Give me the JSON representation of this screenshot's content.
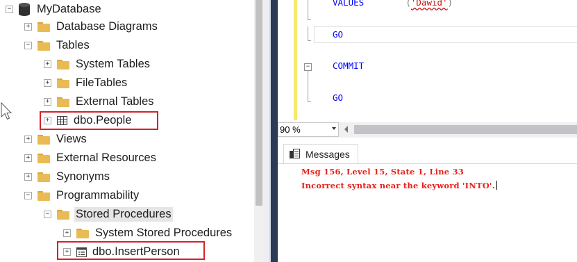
{
  "object_explorer": {
    "nodes": [
      {
        "label": "MyDatabase",
        "expander": "−",
        "icon": "database-icon"
      },
      {
        "label": "Database Diagrams",
        "expander": "+",
        "icon": "folder-icon"
      },
      {
        "label": "Tables",
        "expander": "−",
        "icon": "folder-icon"
      },
      {
        "label": "System Tables",
        "expander": "+",
        "icon": "folder-icon"
      },
      {
        "label": "FileTables",
        "expander": "+",
        "icon": "folder-icon"
      },
      {
        "label": "External Tables",
        "expander": "+",
        "icon": "folder-icon"
      },
      {
        "label": "dbo.People",
        "expander": "+",
        "icon": "table-icon",
        "highlighted": true
      },
      {
        "label": "Views",
        "expander": "+",
        "icon": "folder-icon"
      },
      {
        "label": "External Resources",
        "expander": "+",
        "icon": "folder-icon"
      },
      {
        "label": "Synonyms",
        "expander": "+",
        "icon": "folder-icon"
      },
      {
        "label": "Programmability",
        "expander": "−",
        "icon": "folder-icon"
      },
      {
        "label": "Stored Procedures",
        "expander": "−",
        "icon": "folder-icon",
        "selected": true
      },
      {
        "label": "System Stored Procedures",
        "expander": "+",
        "icon": "folder-icon"
      },
      {
        "label": "dbo.InsertPerson",
        "expander": "+",
        "icon": "stored-procedure-icon",
        "highlighted": true
      }
    ],
    "highlight_color": "#d4222a"
  },
  "editor": {
    "lines": [
      {
        "keyword": "VALUES",
        "punct_open": "(",
        "string": "'Dawid'",
        "punct_close": ")"
      },
      {
        "keyword": "GO"
      },
      {
        "keyword": "COMMIT"
      },
      {
        "keyword": "GO"
      }
    ],
    "fold_expander": "−",
    "keyword_color": "#0000ff",
    "string_color": "#c41212",
    "change_margin_color": "#f7e86e"
  },
  "zoom": {
    "value": "90 %"
  },
  "results": {
    "tab_label": "Messages",
    "messages": [
      "Msg 156, Level 15, State 1, Line 33",
      "Incorrect syntax near the keyword 'INTO'."
    ],
    "error_color": "#e8211a"
  }
}
